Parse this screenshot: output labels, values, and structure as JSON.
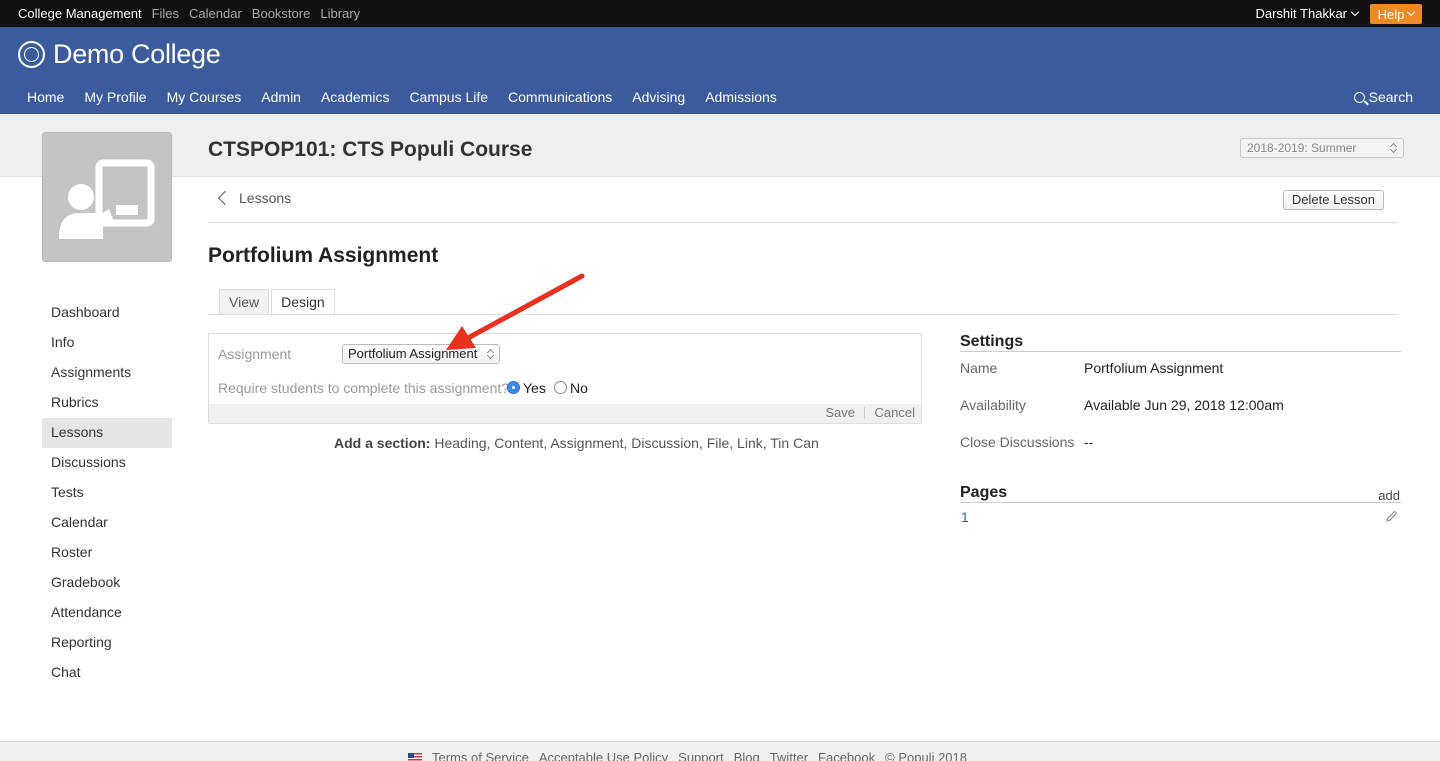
{
  "topbar": {
    "app_links": [
      "College Management",
      "Files",
      "Calendar",
      "Bookstore",
      "Library"
    ],
    "user_name": "Darshit Thakkar",
    "help_label": "Help"
  },
  "header": {
    "college_name": "Demo College",
    "nav": [
      "Home",
      "My Profile",
      "My Courses",
      "Admin",
      "Academics",
      "Campus Life",
      "Communications",
      "Advising",
      "Admissions"
    ],
    "search_label": "Search"
  },
  "course": {
    "title": "CTSPOP101: CTS Populi Course",
    "term": "2018-2019: Summer"
  },
  "leftnav": {
    "items": [
      "Dashboard",
      "Info",
      "Assignments",
      "Rubrics",
      "Lessons",
      "Discussions",
      "Tests",
      "Calendar",
      "Roster",
      "Gradebook",
      "Attendance",
      "Reporting",
      "Chat"
    ],
    "active": "Lessons"
  },
  "lesson": {
    "back_label": "Lessons",
    "delete_label": "Delete Lesson",
    "title": "Portfolium Assignment",
    "tabs": [
      "View",
      "Design"
    ],
    "active_tab": "Design"
  },
  "design_form": {
    "assignment_label": "Assignment",
    "assignment_value": "Portfolium Assignment",
    "require_question": "Require students to complete this assignment?",
    "yes_label": "Yes",
    "no_label": "No",
    "selected": "Yes",
    "save_label": "Save",
    "cancel_label": "Cancel"
  },
  "add_section": {
    "label": "Add a section:",
    "options": "Heading, Content, Assignment, Discussion, File, Link, Tin Can"
  },
  "settings": {
    "title": "Settings",
    "rows": [
      {
        "key": "Name",
        "value": "Portfolium Assignment"
      },
      {
        "key": "Availability",
        "value": "Available Jun 29, 2018 12:00am"
      },
      {
        "key": "Close Discussions",
        "value": "--"
      }
    ]
  },
  "pages": {
    "title": "Pages",
    "add_label": "add",
    "items": [
      "1"
    ]
  },
  "footer": {
    "links": [
      "Terms of Service",
      "Acceptable Use Policy",
      "Support",
      "Blog",
      "Twitter",
      "Facebook",
      "© Populi 2018"
    ]
  },
  "colors": {
    "header_bg": "#3c5b9c",
    "help_bg": "#f08a24",
    "annotation_arrow": "#e8321f"
  }
}
